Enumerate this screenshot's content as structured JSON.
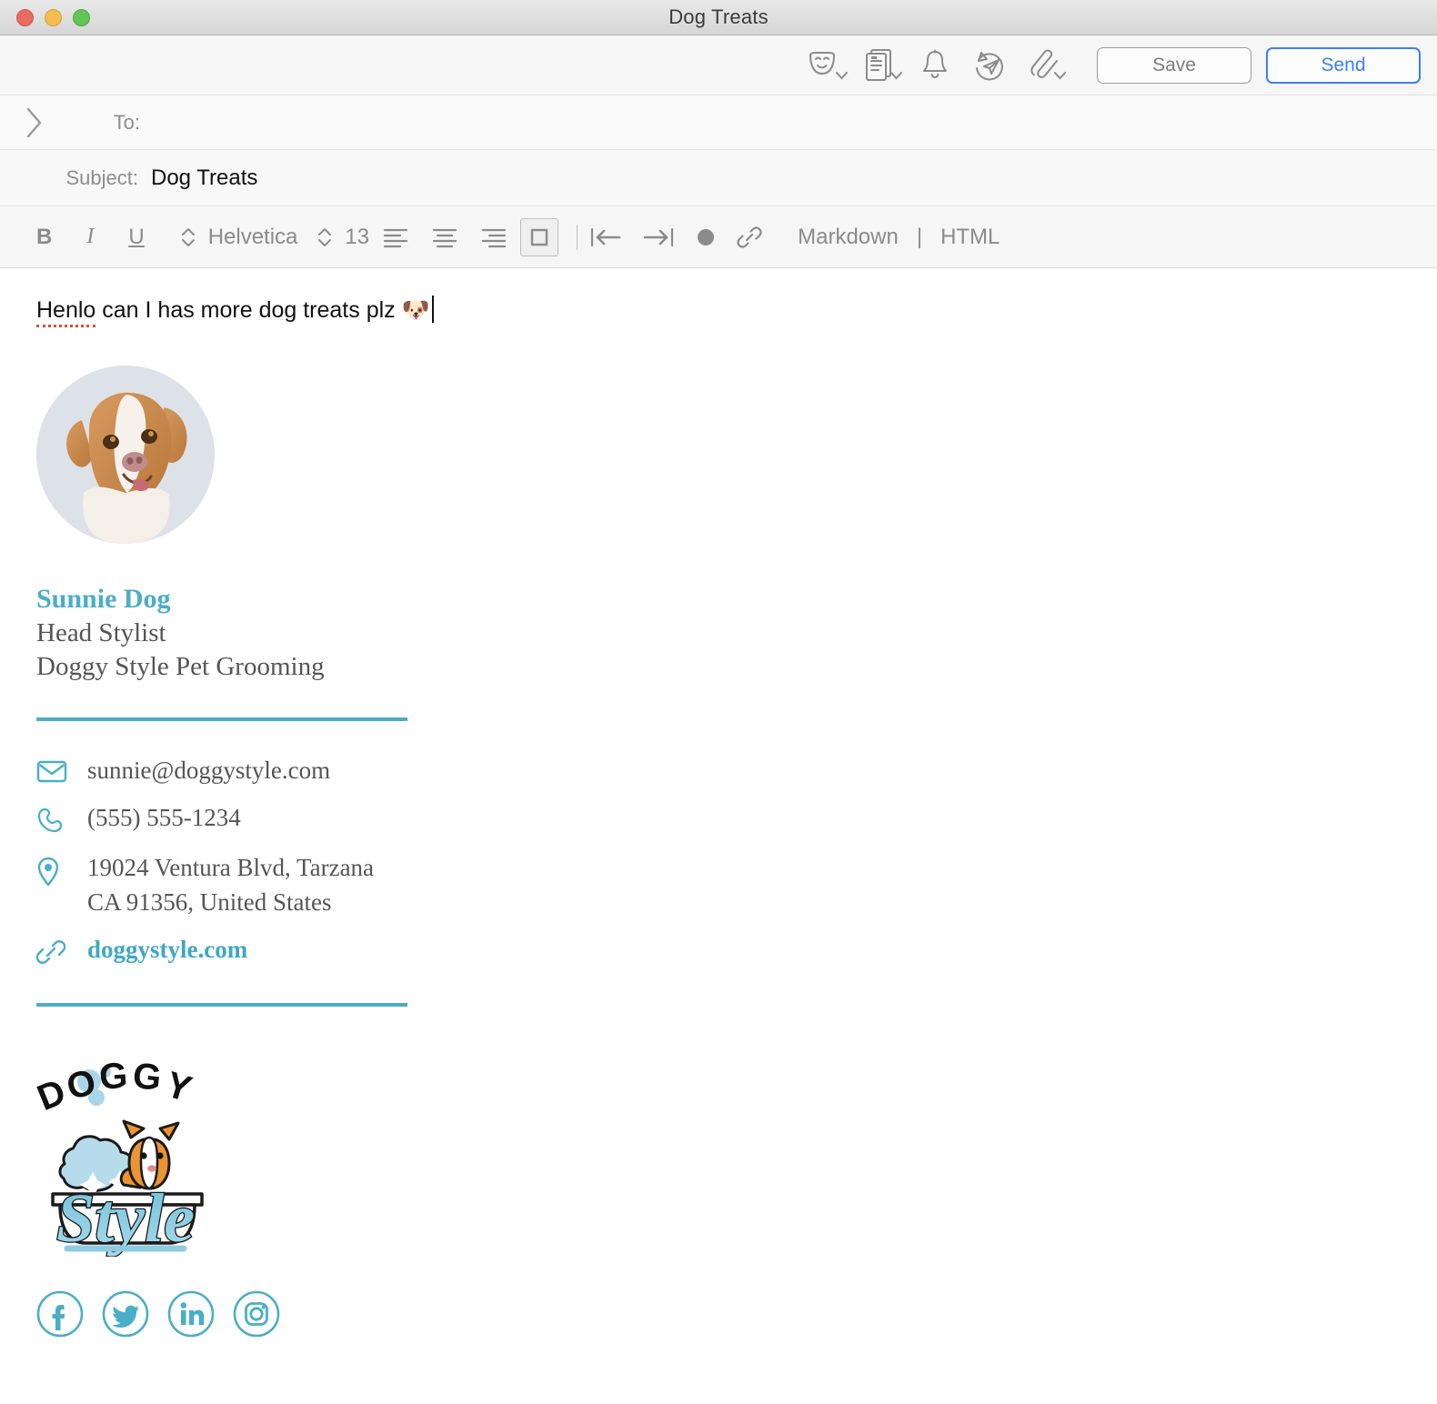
{
  "window": {
    "title": "Dog Treats",
    "traffic_lights": [
      "close",
      "minimize",
      "zoom"
    ]
  },
  "toolbar": {
    "icons": [
      {
        "name": "emoji-masks-icon",
        "label": "Emoji & Symbols",
        "has_chevron": true
      },
      {
        "name": "stationery-icon",
        "label": "Stationery",
        "has_chevron": true
      },
      {
        "name": "bell-icon",
        "label": "Remind Me",
        "has_chevron": false
      },
      {
        "name": "send-later-icon",
        "label": "Send Later",
        "has_chevron": false
      },
      {
        "name": "attachment-clip-icon",
        "label": "Attach File",
        "has_chevron": true
      }
    ],
    "save_label": "Save",
    "send_label": "Send",
    "send_color": "#3b7ff5",
    "save_color": "#7c7c7c"
  },
  "fields": {
    "expander_icon": "chevron-right-icon",
    "to_label": "To:",
    "to_value": "",
    "to_placeholder": "",
    "subject_label": "Subject:",
    "subject_value": "Dog Treats"
  },
  "format_bar": {
    "bold": "B",
    "italic": "I",
    "underline": "U",
    "font_family": "Helvetica",
    "font_size": "13",
    "align_left": "align-left",
    "align_center": "align-center",
    "align_right": "align-right",
    "align_justify": "align-justify",
    "outdent": "outdent",
    "indent": "indent",
    "list_bullet": "bullet-list",
    "link": "insert-link",
    "markdown_label": "Markdown",
    "separator": "|",
    "html_label": "HTML"
  },
  "body": {
    "misspelled_word": "Henlo",
    "text_rest": " can I has more dog treats plz ",
    "emoji": "🐶",
    "full_text": "Henlo can I has more dog treats plz 🐶"
  },
  "signature": {
    "avatar_alt": "photo of brown and white border collie",
    "name": "Sunnie Dog",
    "title": "Head Stylist",
    "company": "Doggy Style Pet Grooming",
    "accent_color": "#4aaec8",
    "contacts": [
      {
        "icon": "envelope-icon",
        "text": "sunnie@doggystyle.com",
        "is_link": false
      },
      {
        "icon": "phone-icon",
        "text": "(555) 555-1234",
        "is_link": false
      },
      {
        "icon": "location-pin-icon",
        "text": "19024 Ventura Blvd, Tarzana\nCA 91356, United States",
        "is_link": false
      },
      {
        "icon": "link-chain-icon",
        "text": "doggystyle.com",
        "is_link": true
      }
    ],
    "logo": {
      "top_word": "DOGGY",
      "script_word": "Style",
      "alt": "Doggy Style Pet Grooming logo"
    },
    "socials": [
      {
        "icon": "facebook-icon",
        "label": "Facebook"
      },
      {
        "icon": "twitter-icon",
        "label": "Twitter"
      },
      {
        "icon": "linkedin-icon",
        "label": "LinkedIn"
      },
      {
        "icon": "instagram-icon",
        "label": "Instagram"
      }
    ]
  }
}
